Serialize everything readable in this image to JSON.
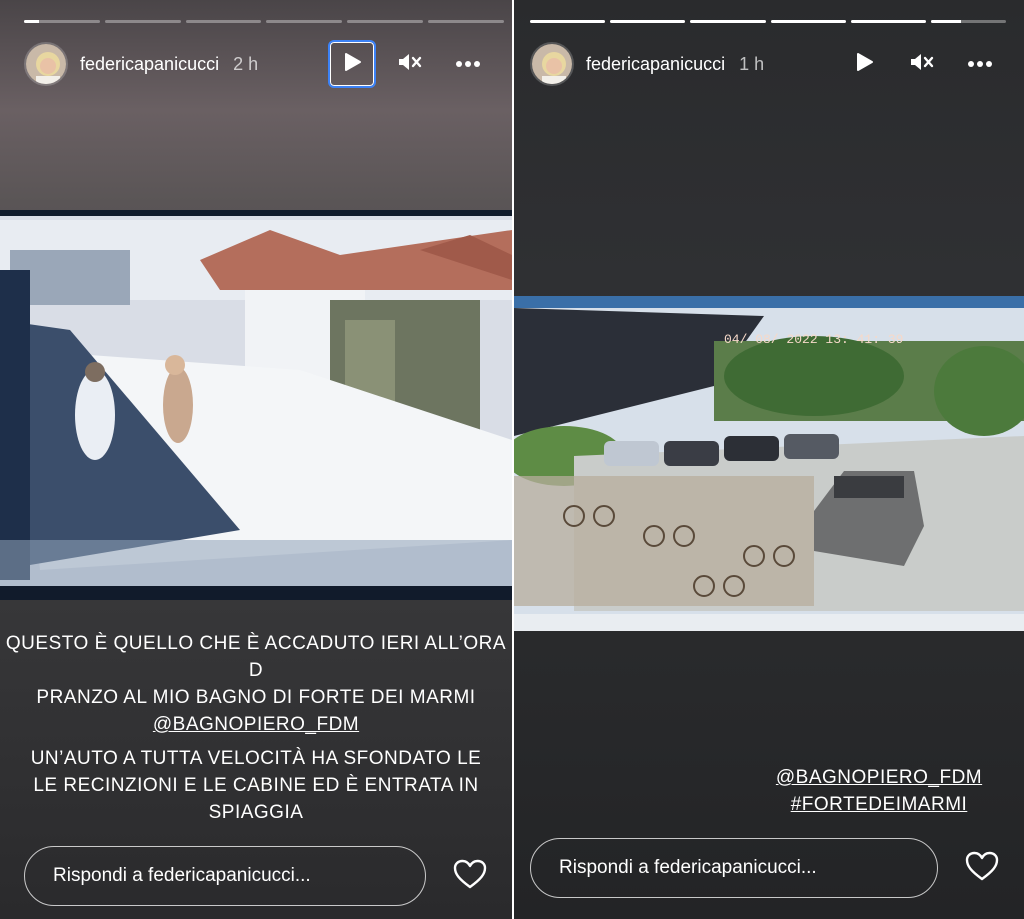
{
  "stories": [
    {
      "username": "federicapanicucci",
      "time": "2 h",
      "progress": [
        0.2,
        0,
        0,
        0,
        0,
        0
      ],
      "caption_lines_1": [
        "QUESTO È QUELLO CHE È ACCADUTO IERI ALL’ORA D",
        "PRANZO AL MIO BAGNO DI FORTE DEI MARMI"
      ],
      "caption_mention": "@BAGNOPIERO_FDM",
      "caption_lines_2": [
        "UN’AUTO A TUTTA VELOCITÀ HA SFONDATO LE",
        "LE RECINZIONI E LE CABINE ED È ENTRATA IN",
        "SPIAGGIA"
      ],
      "reply_placeholder": "Rispondi a federicapanicucci...",
      "icons": {
        "play": "play-icon",
        "mute": "mute-icon",
        "more": "more-icon",
        "heart": "heart-icon"
      }
    },
    {
      "username": "federicapanicucci",
      "time": "1 h",
      "progress": [
        1,
        1,
        1,
        1,
        1,
        0.4
      ],
      "timestamp_overlay": "04/ 08/ 2022  13: 41: 39",
      "tags": [
        "@BAGNOPIERO_FDM",
        "#FORTEDEIMARMI"
      ],
      "reply_placeholder": "Rispondi a federicapanicucci...",
      "icons": {
        "play": "play-icon",
        "mute": "mute-icon",
        "more": "more-icon",
        "heart": "heart-icon"
      }
    }
  ],
  "colors": {
    "focus": "#3c82f6",
    "text": "#ffffff"
  }
}
